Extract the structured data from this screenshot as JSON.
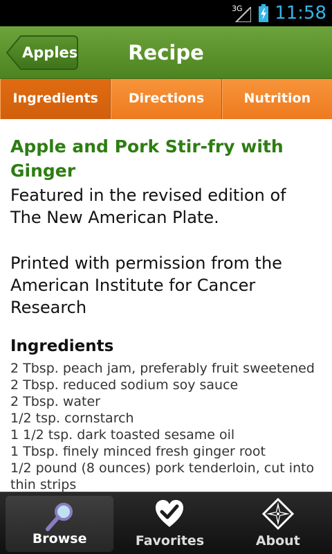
{
  "status_bar": {
    "network": "3G",
    "time": "11:58"
  },
  "header": {
    "back_label": "Apples",
    "title": "Recipe"
  },
  "tabs": [
    {
      "label": "Ingredients",
      "active": true
    },
    {
      "label": "Directions",
      "active": false
    },
    {
      "label": "Nutrition",
      "active": false
    }
  ],
  "recipe": {
    "title": "Apple and Pork Stir-fry with Ginger",
    "description_1": "Featured in the revised edition of The New American Plate.",
    "description_2": "Printed with permission from the American Institute for Cancer Research",
    "ingredients_heading": "Ingredients",
    "ingredients": [
      "2 Tbsp. peach jam, preferably fruit sweetened",
      "2 Tbsp. reduced sodium soy sauce",
      "2 Tbsp. water",
      "1/2 tsp. cornstarch",
      "1 1/2 tsp. dark toasted sesame oil",
      "1 Tbsp. finely minced fresh ginger root",
      "1/2 pound (8 ounces) pork tenderloin, cut into thin strips"
    ]
  },
  "bottom_nav": [
    {
      "label": "Browse",
      "icon": "magnifier-icon",
      "active": true
    },
    {
      "label": "Favorites",
      "icon": "heart-check-icon",
      "active": false
    },
    {
      "label": "About",
      "icon": "compass-star-icon",
      "active": false
    }
  ],
  "colors": {
    "header_green": "#5a9230",
    "tab_orange": "#f28a2c",
    "tab_active": "#d9650f",
    "title_green": "#2e7d12",
    "clock_blue": "#33b5e5"
  }
}
